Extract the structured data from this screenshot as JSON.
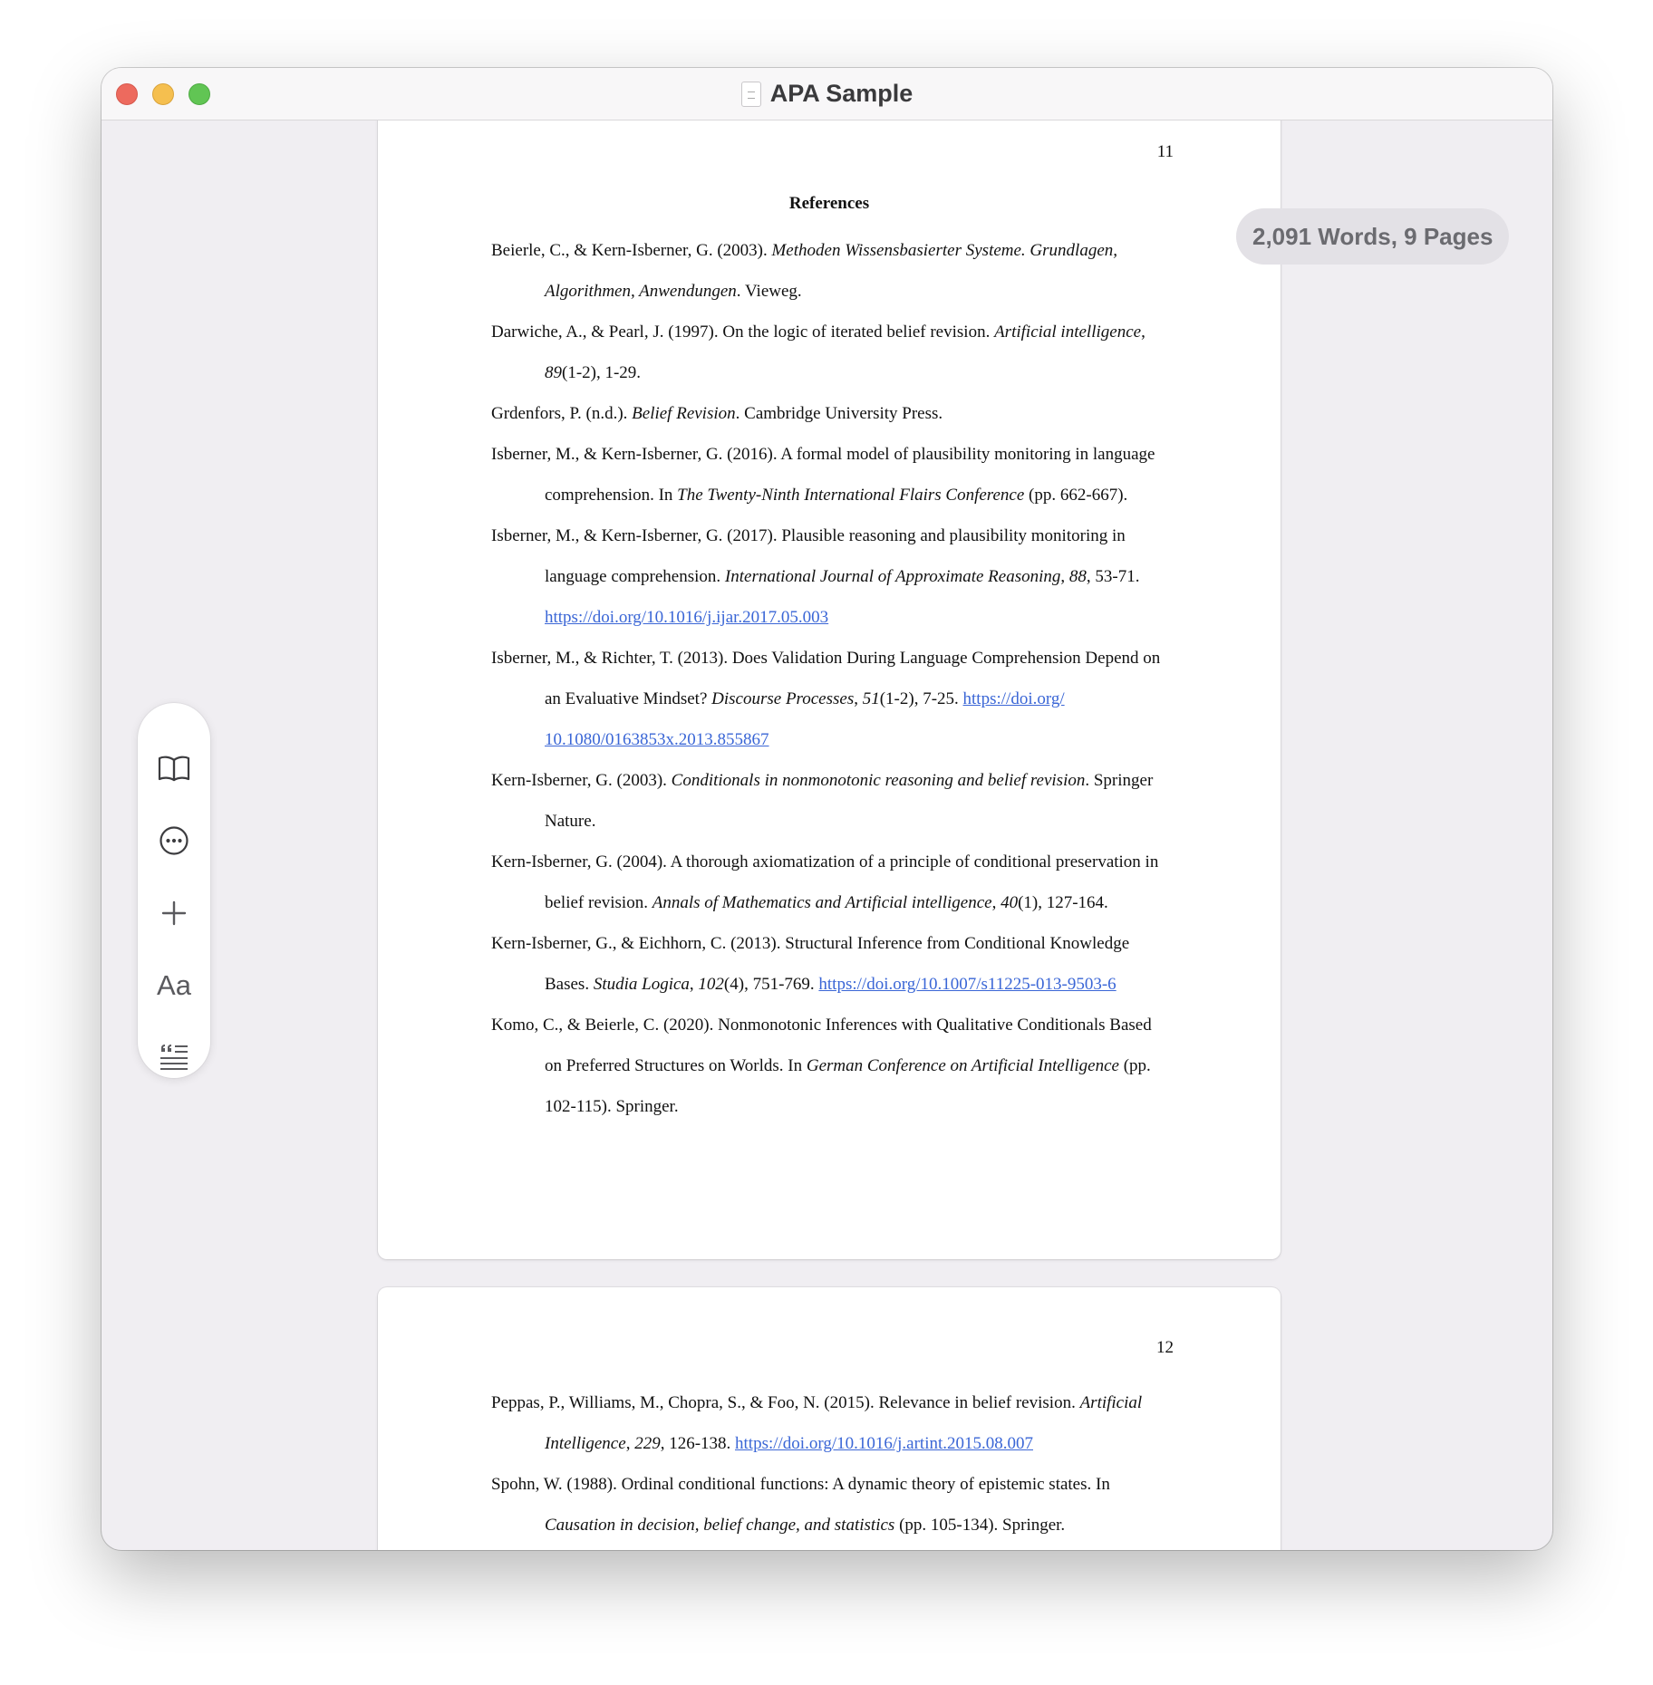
{
  "window": {
    "title": "APA Sample",
    "word_count": "2,091 Words, 9 Pages"
  },
  "colors": {
    "close": "#ed6a5e",
    "minimize": "#f5bf4f",
    "zoom": "#61c554",
    "link": "#3a66d6",
    "background": "#f0eef2"
  },
  "toolbar": {
    "icons": [
      "book-icon",
      "ellipsis-circle-icon",
      "plus-icon",
      "text-format-icon",
      "quote-icon"
    ],
    "format_label": "Aa"
  },
  "page1": {
    "number": "11",
    "heading": "References",
    "refs": {
      "r1": {
        "a": "Beierle, C., & Kern-Isberner, G. (2003). ",
        "b": "Methoden Wissensbasierter Systeme. Grundlagen,",
        "c": "Algorithmen, Anwendungen",
        "d": ". Vieweg."
      },
      "r2": {
        "a": "Darwiche, A., & Pearl, J. (1997). On the logic of iterated belief revision. ",
        "b": "Artificial intelligence",
        "c": ",",
        "d": "89",
        "e": "(1-2), 1-29."
      },
      "r3": {
        "a": "Grdenfors, P. (n.d.). ",
        "b": "Belief Revision",
        "c": ". Cambridge University Press."
      },
      "r4": {
        "a": "Isberner, M., & Kern-Isberner, G. (2016). A formal model of plausibility monitoring in language",
        "b": "comprehension. In ",
        "c": "The Twenty-Ninth International Flairs Conference",
        "d": " (pp. 662-667)."
      },
      "r5": {
        "a": "Isberner, M., & Kern-Isberner, G. (2017). Plausible reasoning and plausibility monitoring in",
        "b": "language comprehension. ",
        "c": "International Journal of Approximate Reasoning",
        "d": ", ",
        "e": "88",
        "f": ", 53-71.",
        "link": "https://doi.org/10.1016/j.ijar.2017.05.003"
      },
      "r6": {
        "a": "Isberner, M., & Richter, T. (2013). Does Validation During Language Comprehension Depend on",
        "b": "an Evaluative Mindset? ",
        "c": "Discourse Processes",
        "d": ", ",
        "e": "51",
        "f": "(1-2), 7-25. ",
        "link1": "https://doi.org/",
        "link2": "10.1080/0163853x.2013.855867"
      },
      "r7": {
        "a": "Kern-Isberner, G. (2003). ",
        "b": "Conditionals in nonmonotonic reasoning and belief revision",
        "c": ". Springer",
        "d": "Nature."
      },
      "r8": {
        "a": "Kern-Isberner, G. (2004). A thorough axiomatization of a principle of conditional preservation in",
        "b": "belief revision. ",
        "c": "Annals of Mathematics and Artificial intelligence",
        "d": ", ",
        "e": "40",
        "f": "(1), 127-164."
      },
      "r9": {
        "a": "Kern-Isberner, G., & Eichhorn, C. (2013). Structural Inference from Conditional Knowledge",
        "b": "Bases. ",
        "c": "Studia Logica",
        "d": ", ",
        "e": "102",
        "f": "(4), 751-769. ",
        "link": "https://doi.org/10.1007/s11225-013-9503-6"
      },
      "r10": {
        "a": "Komo, C., & Beierle, C. (2020). Nonmonotonic Inferences with Qualitative Conditionals Based",
        "b": "on Preferred Structures on Worlds. In ",
        "c": "German Conference on Artificial Intelligence",
        "d": " (pp.",
        "e": "102-115). Springer."
      }
    }
  },
  "page2": {
    "number": "12",
    "refs": {
      "r1": {
        "a": "Peppas, P., Williams, M., Chopra, S., & Foo, N. (2015). Relevance in belief revision. ",
        "b": "Artificial",
        "c": "Intelligence",
        "d": ", ",
        "e": "229",
        "f": ", 126-138. ",
        "link": "https://doi.org/10.1016/j.artint.2015.08.007"
      },
      "r2": {
        "a": "Spohn, W. (1988). Ordinal conditional functions: A dynamic theory of epistemic states. In",
        "b": "Causation in decision, belief change, and statistics",
        "c": " (pp. 105-134). Springer."
      }
    }
  }
}
